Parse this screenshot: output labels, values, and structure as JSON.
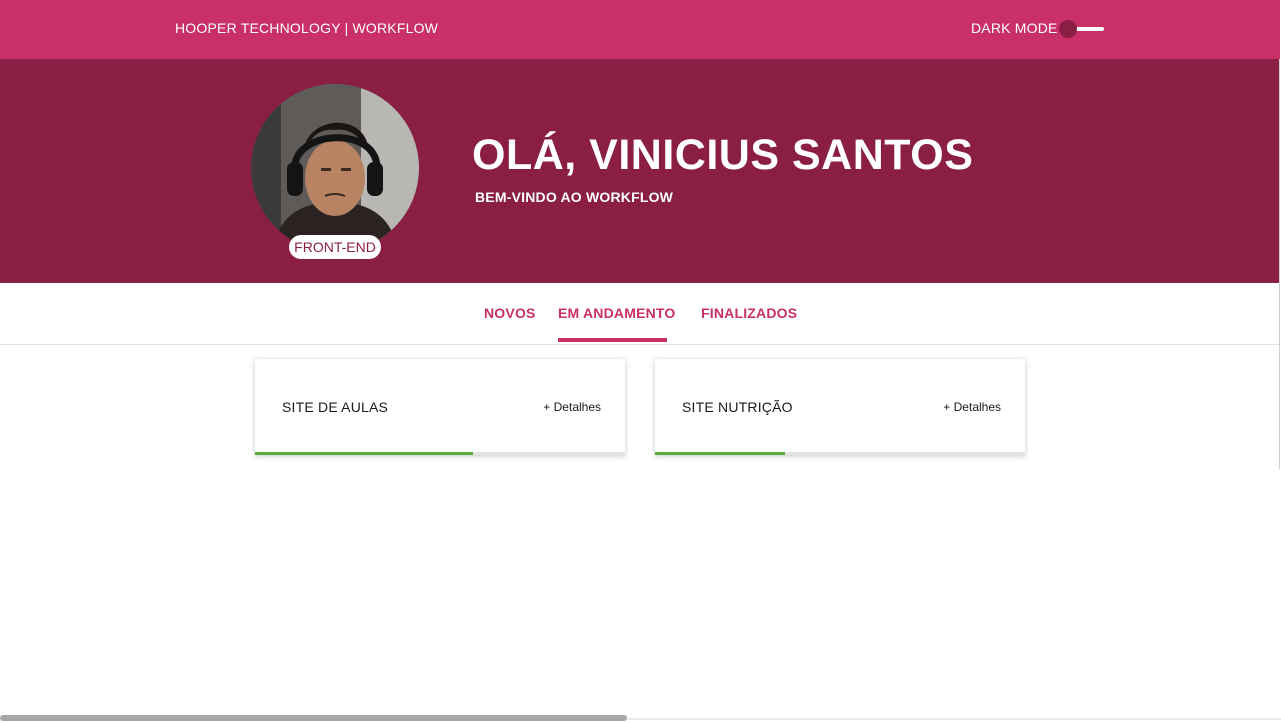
{
  "header": {
    "brand": "HOOPER TECHNOLOGY | WORKFLOW",
    "dark_mode_label": "DARK MODE",
    "dark_mode_enabled": false
  },
  "profile": {
    "greeting": "OLÁ, VINICIUS SANTOS",
    "welcome": "BEM-VINDO AO WORKFLOW",
    "role": "FRONT-END"
  },
  "tabs": [
    {
      "label": "NOVOS",
      "active": false
    },
    {
      "label": "EM ANDAMENTO",
      "active": true
    },
    {
      "label": "FINALIZADOS",
      "active": false
    }
  ],
  "projects": [
    {
      "title": "SITE DE AULAS",
      "details_label": "+ Detalhes",
      "progress": 0.59
    },
    {
      "title": "SITE NUTRIÇÃO",
      "details_label": "+ Detalhes",
      "progress": 0.35
    }
  ],
  "colors": {
    "header_bg": "#c83067",
    "hero_bg": "#8a1e45",
    "tab_accent": "#c83067",
    "progress": "#5aad3d"
  }
}
